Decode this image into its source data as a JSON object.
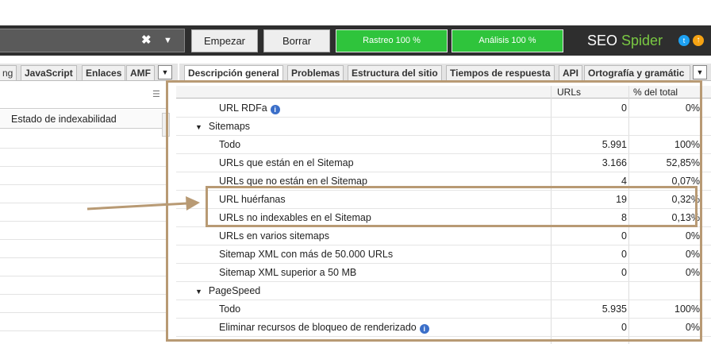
{
  "toolbar": {
    "url_clear_icon": "close-icon",
    "start_label": "Empezar",
    "clear_label": "Borrar",
    "crawl_progress_label": "Rastreo 100 %",
    "crawl_progress": 1.0,
    "analysis_progress_label": "Análisis 100 %",
    "analysis_progress": 1.0,
    "brand_seo": "SEO",
    "brand_spider": "Spider"
  },
  "left_tabs": [
    {
      "label": "ng"
    },
    {
      "label": "JavaScript"
    },
    {
      "label": "Enlaces"
    },
    {
      "label": "AMF"
    }
  ],
  "right_tabs": [
    {
      "label": "Descripción general"
    },
    {
      "label": "Problemas"
    },
    {
      "label": "Estructura del sitio"
    },
    {
      "label": "Tiempos de respuesta"
    },
    {
      "label": "API"
    },
    {
      "label": "Ortografía y gramátic"
    }
  ],
  "left_table": {
    "column_header": "Estado de indexabilidad"
  },
  "right_table": {
    "headers": {
      "urls": "URLs",
      "pct": "% del total"
    },
    "rows": [
      {
        "label": "URL RDFa",
        "urls": "0",
        "pct": "0%",
        "indent": 2,
        "info": true
      },
      {
        "label": "Sitemaps",
        "urls": "",
        "pct": "",
        "indent": 1,
        "group": true
      },
      {
        "label": "Todo",
        "urls": "5.991",
        "pct": "100%",
        "indent": 2
      },
      {
        "label": "URLs que están en el Sitemap",
        "urls": "3.166",
        "pct": "52,85%",
        "indent": 2
      },
      {
        "label": "URLs que no están en el Sitemap",
        "urls": "4",
        "pct": "0,07%",
        "indent": 2
      },
      {
        "label": "URL huérfanas",
        "urls": "19",
        "pct": "0,32%",
        "indent": 2
      },
      {
        "label": "URLs no indexables en el Sitemap",
        "urls": "8",
        "pct": "0,13%",
        "indent": 2
      },
      {
        "label": "URLs en varios sitemaps",
        "urls": "0",
        "pct": "0%",
        "indent": 2
      },
      {
        "label": "Sitemap XML con más de 50.000 URLs",
        "urls": "0",
        "pct": "0%",
        "indent": 2
      },
      {
        "label": "Sitemap XML superior a 50 MB",
        "urls": "0",
        "pct": "0%",
        "indent": 2
      },
      {
        "label": "PageSpeed",
        "urls": "",
        "pct": "",
        "indent": 1,
        "group": true
      },
      {
        "label": "Todo",
        "urls": "5.935",
        "pct": "100%",
        "indent": 2
      },
      {
        "label": "Eliminar recursos de bloqueo de renderizado",
        "urls": "0",
        "pct": "0%",
        "indent": 2,
        "info": true
      }
    ]
  },
  "colors": {
    "annotation": "#b89a74",
    "progress_green": "#2fc43c",
    "brand_green": "#7ac943",
    "toolbar_bg": "#2e2e2e"
  }
}
